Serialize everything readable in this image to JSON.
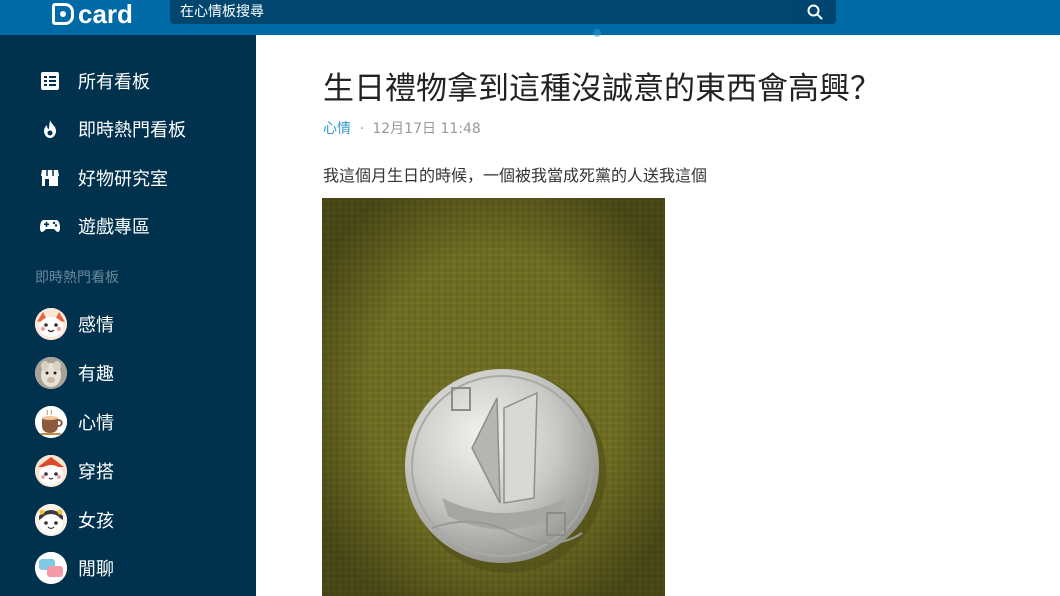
{
  "header": {
    "logo_text": "card",
    "search_placeholder": "在心情板搜尋",
    "colors": {
      "header_bg": "#006aa6",
      "search_bg": "#00466f"
    }
  },
  "sidebar": {
    "nav": [
      {
        "label": "所有看板",
        "icon": "board-list-icon"
      },
      {
        "label": "即時熱門看板",
        "icon": "fire-icon"
      },
      {
        "label": "好物研究室",
        "icon": "store-icon"
      },
      {
        "label": "遊戲專區",
        "icon": "gamepad-icon"
      }
    ],
    "section_title": "即時熱門看板",
    "forums": [
      {
        "label": "感情",
        "icon": "forum-avatar-love"
      },
      {
        "label": "有趣",
        "icon": "forum-avatar-funny"
      },
      {
        "label": "心情",
        "icon": "forum-avatar-mood"
      },
      {
        "label": "穿搭",
        "icon": "forum-avatar-dressup"
      },
      {
        "label": "女孩",
        "icon": "forum-avatar-girl"
      },
      {
        "label": "閒聊",
        "icon": "forum-avatar-talk"
      }
    ],
    "colors": {
      "bg": "#00324e",
      "section_title": "#6a8799"
    }
  },
  "post": {
    "title": "生日禮物拿到這種沒誠意的東西會高興？",
    "forum": "心情",
    "separator": "·",
    "timestamp": "12月17日 11:48",
    "body": "我這個月生日的時候，一個被我當成死黨的人送我這個",
    "image": "coin-photo"
  }
}
